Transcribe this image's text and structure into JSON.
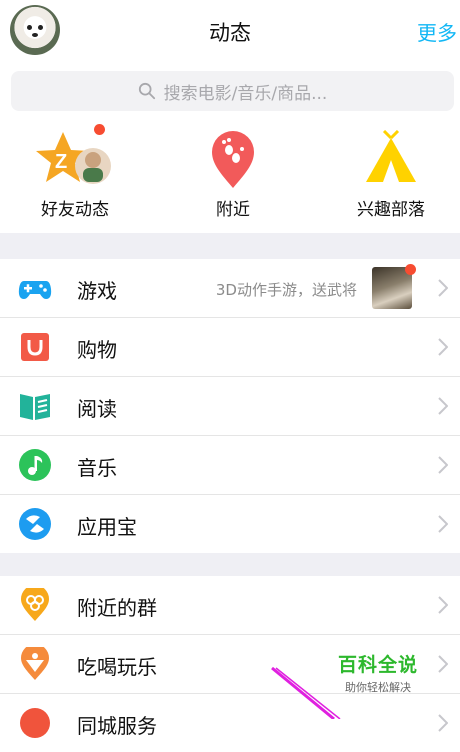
{
  "header": {
    "title": "动态",
    "more_label": "更多"
  },
  "search": {
    "placeholder": "搜索电影/音乐/商品..."
  },
  "quick_items": [
    {
      "label": "好友动态",
      "icon": "friend-feed-star-icon"
    },
    {
      "label": "附近",
      "icon": "nearby-pin-icon"
    },
    {
      "label": "兴趣部落",
      "icon": "interest-tribe-tent-icon"
    }
  ],
  "menu_group1": [
    {
      "label": "游戏",
      "icon": "gamepad-icon",
      "extra": "3D动作手游，送武将"
    },
    {
      "label": "购物",
      "icon": "shopping-bag-icon"
    },
    {
      "label": "阅读",
      "icon": "book-icon"
    },
    {
      "label": "音乐",
      "icon": "music-note-icon"
    },
    {
      "label": "应用宝",
      "icon": "app-store-icon"
    }
  ],
  "menu_group2": [
    {
      "label": "附近的群",
      "icon": "nearby-groups-icon"
    },
    {
      "label": "吃喝玩乐",
      "icon": "food-fun-icon"
    },
    {
      "label": "同城服务",
      "icon": "city-service-icon"
    }
  ],
  "watermark": {
    "main": "百科全说",
    "sub": "助你轻松解决"
  },
  "colors": {
    "accent_blue": "#12b7f5",
    "badge_red": "#f74c31",
    "watermark_green": "#2db82d"
  }
}
